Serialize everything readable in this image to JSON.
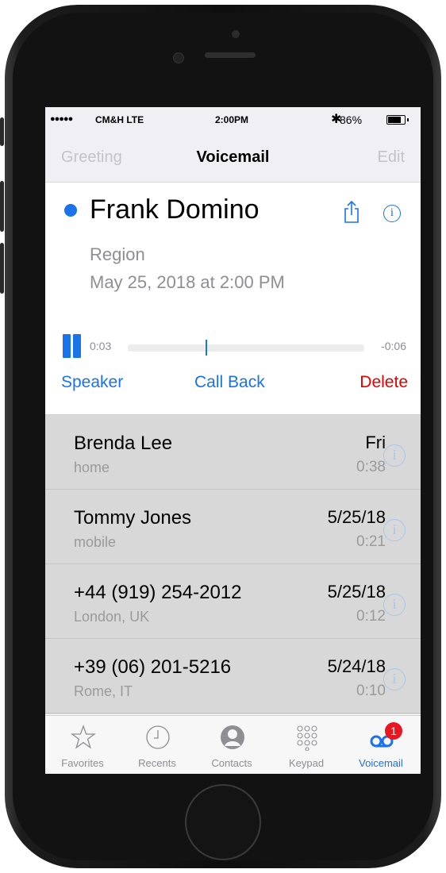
{
  "status_bar": {
    "signal": "●●●●●",
    "carrier": "CM&H  LTE",
    "time": "2:00PM",
    "bluetooth": "✱",
    "battery_percent": "86%",
    "battery_level": 0.86
  },
  "nav": {
    "left": "Greeting",
    "title": "Voicemail",
    "right": "Edit"
  },
  "detail": {
    "caller": "Frank Domino",
    "location": "Region",
    "date": "May 25, 2018 at 2:00 PM",
    "elapsed": "0:03",
    "remaining": "-0:06",
    "progress": 0.33,
    "actions": {
      "speaker": "Speaker",
      "call_back": "Call Back",
      "delete": "Delete"
    },
    "colors": {
      "accent": "#1a73e8",
      "delete": "#e60000"
    }
  },
  "voicemails": [
    {
      "name": "Brenda Lee",
      "label": "home",
      "when": "Fri",
      "duration": "0:38"
    },
    {
      "name": "Tommy Jones",
      "label": "mobile",
      "when": "5/25/18",
      "duration": "0:21"
    },
    {
      "name": "+44 (919) 254-2012",
      "label": "London, UK",
      "when": "5/25/18",
      "duration": "0:12"
    },
    {
      "name": "+39 (06) 201-5216",
      "label": "Rome, IT",
      "when": "5/24/18",
      "duration": "0:10"
    }
  ],
  "tabs": [
    {
      "label": "Favorites",
      "icon": "star-icon"
    },
    {
      "label": "Recents",
      "icon": "clock-icon"
    },
    {
      "label": "Contacts",
      "icon": "person-icon"
    },
    {
      "label": "Keypad",
      "icon": "keypad-icon"
    },
    {
      "label": "Voicemail",
      "icon": "voicemail-icon",
      "badge": "1",
      "active": true
    }
  ]
}
